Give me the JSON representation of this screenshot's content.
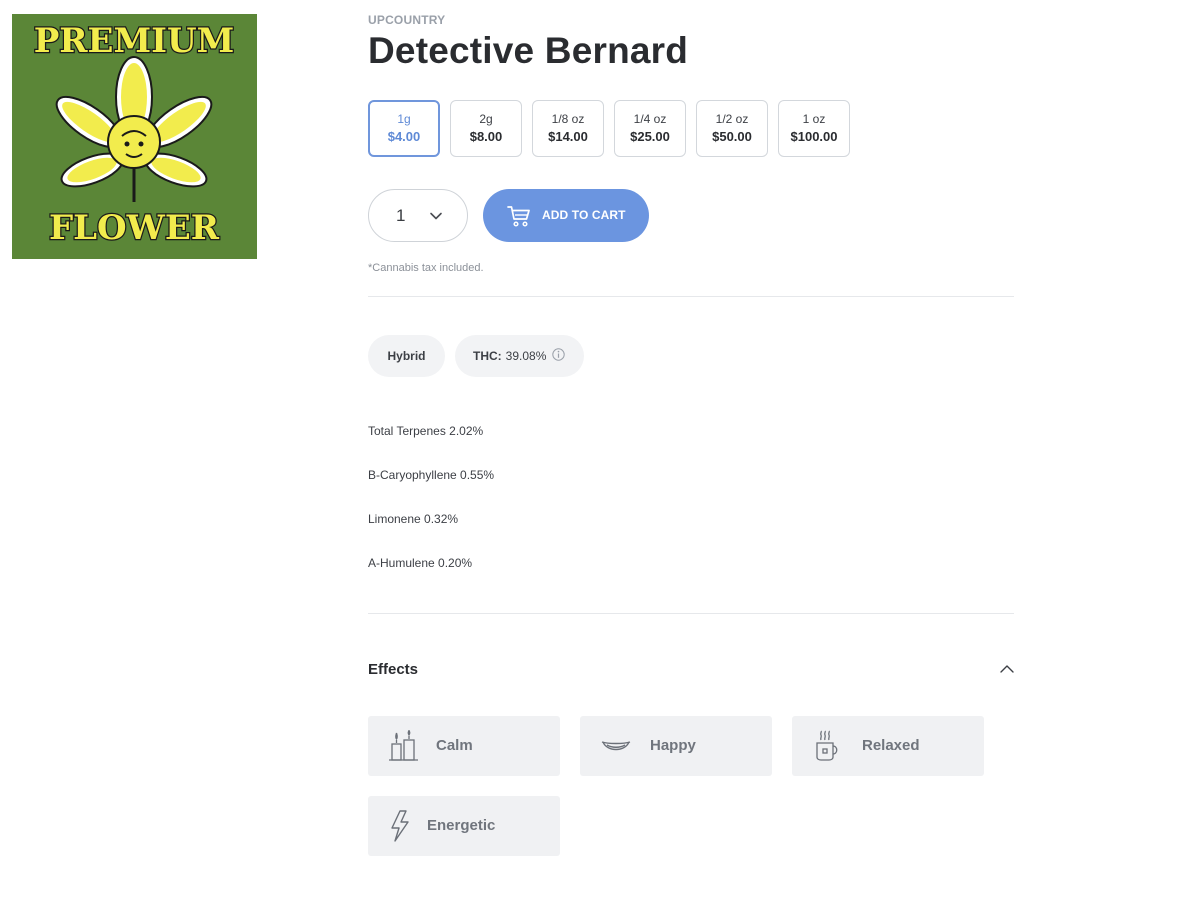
{
  "product": {
    "image_alt": "PREMIUM FLOWER",
    "image_text_top": "PREMIUM",
    "image_text_bottom": "FLOWER",
    "brand": "UPCOUNTRY",
    "name": "Detective Bernard"
  },
  "weights": [
    {
      "label": "1g",
      "price": "$4.00",
      "selected": true
    },
    {
      "label": "2g",
      "price": "$8.00",
      "selected": false
    },
    {
      "label": "1/8 oz",
      "price": "$14.00",
      "selected": false
    },
    {
      "label": "1/4 oz",
      "price": "$25.00",
      "selected": false
    },
    {
      "label": "1/2 oz",
      "price": "$50.00",
      "selected": false
    },
    {
      "label": "1 oz",
      "price": "$100.00",
      "selected": false
    }
  ],
  "purchase": {
    "quantity": "1",
    "add_to_cart_label": "ADD TO CART",
    "tax_note": "*Cannabis tax included."
  },
  "attributes": {
    "type": "Hybrid",
    "thc_label": "THC:",
    "thc_value": "39.08%"
  },
  "terpenes": [
    "Total Terpenes 2.02%",
    "B-Caryophyllene 0.55%",
    "Limonene 0.32%",
    "A-Humulene 0.20%"
  ],
  "effects": {
    "heading": "Effects",
    "items": [
      {
        "label": "Calm",
        "icon": "candles-icon"
      },
      {
        "label": "Happy",
        "icon": "smile-icon"
      },
      {
        "label": "Relaxed",
        "icon": "teacup-icon"
      },
      {
        "label": "Energetic",
        "icon": "lightning-icon"
      }
    ]
  },
  "colors": {
    "accent": "#6b95e0",
    "selected_text": "#5f8ad6",
    "image_background": "#5b8637",
    "image_text": "#f2ec4d",
    "effect_tile": "#f0f1f3"
  }
}
